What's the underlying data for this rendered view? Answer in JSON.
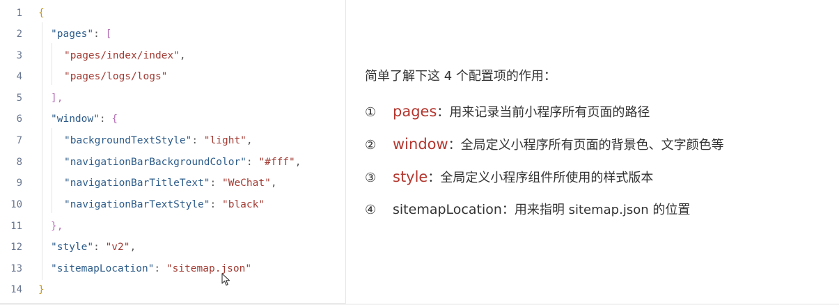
{
  "code": {
    "lines": [
      {
        "n": "1"
      },
      {
        "n": "2",
        "key": "\"pages\"",
        "open": "["
      },
      {
        "n": "3",
        "str": "\"pages/index/index\""
      },
      {
        "n": "4",
        "str": "\"pages/logs/logs\""
      },
      {
        "n": "5",
        "close": "],"
      },
      {
        "n": "6",
        "key": "\"window\"",
        "open": "{"
      },
      {
        "n": "7",
        "key": "\"backgroundTextStyle\"",
        "str": "\"light\""
      },
      {
        "n": "8",
        "key": "\"navigationBarBackgroundColor\"",
        "str": "\"#fff\""
      },
      {
        "n": "9",
        "key": "\"navigationBarTitleText\"",
        "str": "\"WeChat\""
      },
      {
        "n": "10",
        "key": "\"navigationBarTextStyle\"",
        "str": "\"black\""
      },
      {
        "n": "11",
        "close": "},"
      },
      {
        "n": "12",
        "key": "\"style\"",
        "str": "\"v2\""
      },
      {
        "n": "13",
        "key": "\"sitemapLocation\"",
        "str": "\"sitemap.json\""
      },
      {
        "n": "14"
      }
    ],
    "punct": {
      "colon": ": ",
      "comma": ",",
      "open_brace": "{",
      "close_brace": "}"
    }
  },
  "description": {
    "title": "简单了解下这 4 个配置项的作用：",
    "items": [
      {
        "num": "①",
        "key": "pages",
        "text": "：用来记录当前小程序所有页面的路径"
      },
      {
        "num": "②",
        "key": "window",
        "text": "：全局定义小程序所有页面的背景色、文字颜色等"
      },
      {
        "num": "③",
        "key": "style",
        "text": "：全局定义小程序组件所使用的样式版本"
      },
      {
        "num": "④",
        "key": "sitemapLocation",
        "text": "：用来指明 sitemap.json 的位置"
      }
    ]
  },
  "colors": {
    "keyword_highlight": "#b3362e",
    "json_key": "#2d5c8a",
    "json_string": "#a33b33",
    "brace": "#c29a2a",
    "bracket": "#b46fb5"
  },
  "icons": {
    "cursor": "mouse-pointer-icon"
  }
}
